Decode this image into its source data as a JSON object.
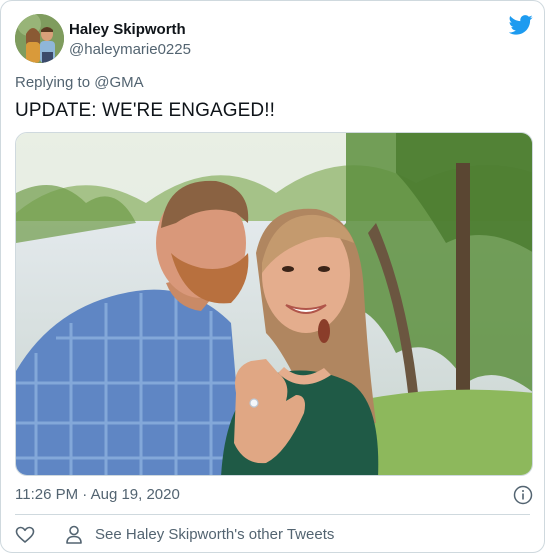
{
  "tweet": {
    "author_name": "Haley Skipworth",
    "author_handle": "@haleymarie0225",
    "replying_prefix": "Replying to ",
    "replying_to": "@GMA",
    "text": "UPDATE: WE'RE ENGAGED!!",
    "timestamp": "11:26 PM · Aug 19, 2020",
    "other_tweets_label": "See Haley Skipworth's other Tweets"
  },
  "icons": {
    "brand": "twitter-bird-icon",
    "info": "info-icon",
    "like": "heart-icon",
    "profile": "person-icon"
  },
  "colors": {
    "brand_blue": "#1d9bf0",
    "secondary_text": "#536471",
    "primary_text": "#0f1419",
    "border": "#cfd9de"
  }
}
